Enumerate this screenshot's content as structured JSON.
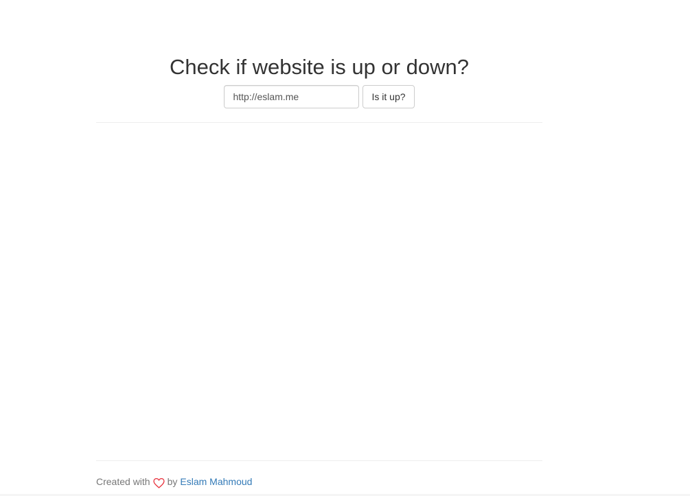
{
  "header": {
    "title": "Check if website is up or down?"
  },
  "form": {
    "url_value": "http://eslam.me",
    "url_placeholder": "http://eslam.me",
    "submit_label": "Is it up?"
  },
  "footer": {
    "created_with": "Created with",
    "heart_icon": "heart-icon",
    "by": "by",
    "author": "Eslam Mahmoud"
  },
  "colors": {
    "link": "#337ab7",
    "heart": "#e8303b",
    "muted_text": "#777777"
  }
}
